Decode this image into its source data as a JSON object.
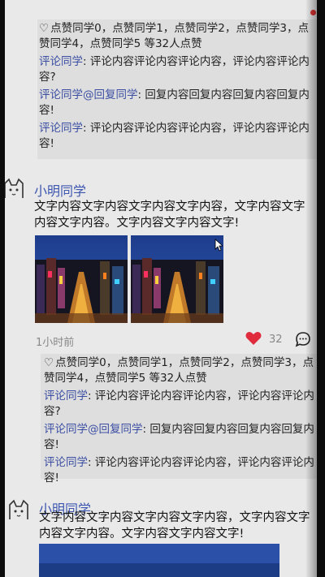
{
  "feed": {
    "top_comments": {
      "likes": "点赞同学0，点赞同学1，点赞同学2，点赞同学3，点赞同学4，点赞同学5 等32人点赞",
      "comments": [
        {
          "author": "评论同学",
          "text": ": 评论内容评论内容评论内容，评论内容评论内容?"
        },
        {
          "author": "评论同学@回复同学",
          "text": ": 回复内容回复内容回复内容回复内容!"
        },
        {
          "author": "评论同学",
          "text": ": 评论内容评论内容评论内容，评论内容评论内容!"
        }
      ]
    },
    "post1": {
      "username": "小明同学",
      "text": "文字内容文字内容文字内容文字内容，文字内容文字内容文字内容。文字内容文字内容文字!",
      "time": "1小时前",
      "like_count": "32",
      "likes": "点赞同学0，点赞同学1，点赞同学2，点赞同学3，点赞同学4，点赞同学5 等32人点赞",
      "comments": [
        {
          "author": "评论同学",
          "text": ": 评论内容评论内容评论内容，评论内容评论内容?"
        },
        {
          "author": "评论同学@回复同学",
          "text": ": 回复内容回复内容回复内容回复内容!"
        },
        {
          "author": "评论同学",
          "text": ": 评论内容评论内容评论内容，评论内容评论内容!"
        }
      ]
    },
    "post2": {
      "username": "小明同学",
      "text": "文字内容文字内容文字内容文字内容，文字内容文字内容文字内容。文字内容文字内容文字!"
    }
  },
  "colors": {
    "like_red": "#e02b3c",
    "name_blue": "#3d56b0",
    "comment_bg": "#dedede"
  },
  "icons": {
    "heart": "heart-icon",
    "comment": "comment-bubble-icon",
    "avatar": "cat-avatar-icon"
  }
}
